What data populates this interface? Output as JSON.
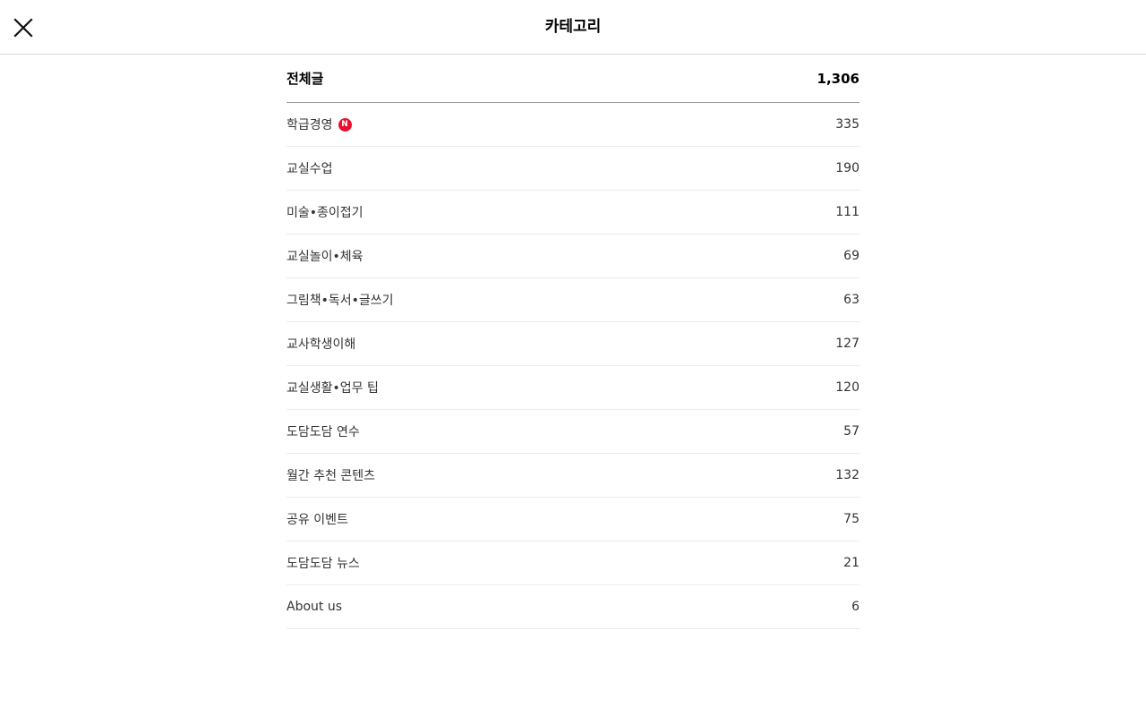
{
  "header": {
    "title": "카테고리",
    "close_icon": "close-icon"
  },
  "total": {
    "label": "전체글",
    "count": "1,306"
  },
  "categories": [
    {
      "label": "학급경영",
      "count": "335",
      "badge": "N"
    },
    {
      "label": "교실수업",
      "count": "190"
    },
    {
      "label": "미술•종이접기",
      "count": "111"
    },
    {
      "label": "교실놀이•체육",
      "count": "69"
    },
    {
      "label": "그림책•독서•글쓰기",
      "count": "63"
    },
    {
      "label": "교사학생이해",
      "count": "127"
    },
    {
      "label": "교실생활•업무 팁",
      "count": "120"
    },
    {
      "label": "도담도담 연수",
      "count": "57"
    },
    {
      "label": "월간 추천 콘텐츠",
      "count": "132"
    },
    {
      "label": "공유 이벤트",
      "count": "75"
    },
    {
      "label": "도담도담 뉴스",
      "count": "21"
    },
    {
      "label": "About us",
      "count": "6"
    }
  ],
  "colors": {
    "badge": "#e8102e"
  }
}
